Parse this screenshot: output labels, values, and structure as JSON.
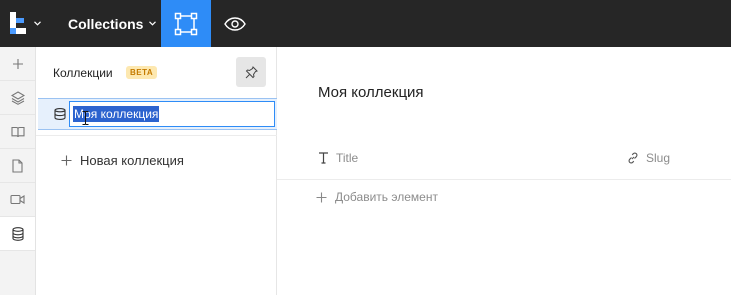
{
  "topbar": {
    "collections_label": "Collections"
  },
  "panel": {
    "title": "Коллекции",
    "badge": "BETA",
    "selected_collection": "Моя коллекция",
    "new_collection_label": "Новая коллекция"
  },
  "main": {
    "title": "Моя коллекция",
    "columns": [
      {
        "label": "Title",
        "icon": "text-icon"
      },
      {
        "label": "Slug",
        "icon": "link-icon"
      }
    ],
    "add_element_label": "Добавить элемент"
  },
  "colors": {
    "topbar": "#262626",
    "accent": "#2e8cf7",
    "selection": "#2c63cf",
    "badge_bg": "#fde8b0",
    "badge_text": "#c57b00"
  }
}
